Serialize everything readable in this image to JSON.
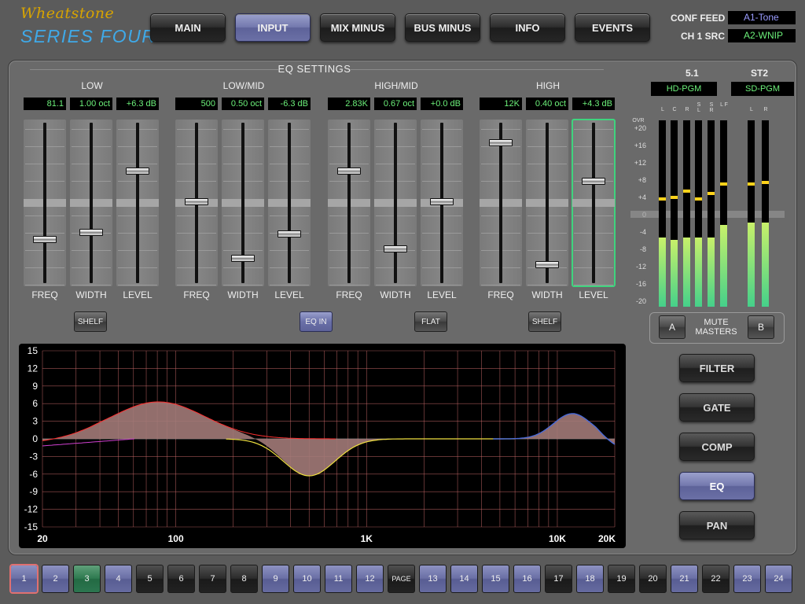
{
  "logo": {
    "line1": "Wheatstone",
    "line2": "SERIES FOUR"
  },
  "topnav": [
    {
      "label": "MAIN",
      "active": false
    },
    {
      "label": "INPUT",
      "active": true
    },
    {
      "label": "MIX MINUS",
      "active": false
    },
    {
      "label": "BUS MINUS",
      "active": false
    },
    {
      "label": "INFO",
      "active": false
    },
    {
      "label": "EVENTS",
      "active": false
    }
  ],
  "sources": {
    "conf_feed_label": "CONF FEED",
    "conf_feed_value": "A1-Tone",
    "conf_feed_color": "#9a9cff",
    "ch_src_label": "CH 1 SRC",
    "ch_src_value": "A2-WNIP",
    "ch_src_color": "#6cf07a"
  },
  "eq": {
    "title": "EQ SETTINGS",
    "bands": [
      {
        "name": "LOW",
        "freq": "81.1",
        "width": "1.00 oct",
        "level": "+6.3 dB",
        "knobs": [
          0.74,
          0.69,
          0.29
        ],
        "button": "SHELF",
        "button_active": false
      },
      {
        "name": "LOW/MID",
        "freq": "500",
        "width": "0.50 oct",
        "level": "-6.3 dB",
        "knobs": [
          0.49,
          0.86,
          0.7
        ],
        "button": "EQ IN",
        "button_active": true
      },
      {
        "name": "HIGH/MID",
        "freq": "2.83K",
        "width": "0.67 oct",
        "level": "+0.0 dB",
        "knobs": [
          0.29,
          0.8,
          0.49
        ],
        "button": "FLAT",
        "button_active": false
      },
      {
        "name": "HIGH",
        "freq": "12K",
        "width": "0.40 oct",
        "level": "+4.3 dB",
        "knobs": [
          0.11,
          0.9,
          0.36
        ],
        "button": "SHELF",
        "button_active": false
      }
    ],
    "fader_labels": [
      "FREQ",
      "WIDTH",
      "LEVEL"
    ],
    "selected_fader": "HIGH-LEVEL"
  },
  "graph": {
    "y_ticks": [
      "15",
      "12",
      "9",
      "6",
      "3",
      "0",
      "-3",
      "-6",
      "-9",
      "-12",
      "-15"
    ],
    "x_ticks": [
      "20",
      "100",
      "1K",
      "10K",
      "20K"
    ],
    "colors": {
      "grid": "#c86a6a",
      "fill": "#a27a78",
      "low": "#ff3030",
      "mid": "#f0e040",
      "high": "#4a6ad8",
      "lowshelf": "#d040d0"
    }
  },
  "meters": {
    "group1": "5.1",
    "group2": "ST2",
    "src1": "HD-PGM",
    "src2": "SD-PGM",
    "over_label": "OVR",
    "db_labels": [
      "+20",
      "+16",
      "+12",
      "+8",
      "+4",
      "0",
      "-4",
      "-8",
      "-12",
      "-16",
      "-20"
    ],
    "ch1": [
      "L",
      "C",
      "R",
      "S L",
      "S R",
      "L F"
    ],
    "ch2": [
      "L",
      "R"
    ],
    "levels": [
      0.37,
      0.36,
      0.37,
      0.37,
      0.37,
      0.44,
      0.45,
      0.45
    ],
    "peaks": [
      0.57,
      0.58,
      0.61,
      0.57,
      0.6,
      0.65,
      0.65,
      0.66
    ]
  },
  "mute": {
    "a": "A",
    "b": "B",
    "label1": "MUTE",
    "label2": "MASTERS"
  },
  "right_buttons": [
    {
      "label": "FILTER",
      "active": false
    },
    {
      "label": "GATE",
      "active": false
    },
    {
      "label": "COMP",
      "active": false
    },
    {
      "label": "EQ",
      "active": true
    },
    {
      "label": "PAN",
      "active": false
    }
  ],
  "channels": [
    {
      "label": "1",
      "style": "sel"
    },
    {
      "label": "2",
      "style": "blue"
    },
    {
      "label": "3",
      "style": "green"
    },
    {
      "label": "4",
      "style": "blue"
    },
    {
      "label": "5",
      "style": "dark"
    },
    {
      "label": "6",
      "style": "dark"
    },
    {
      "label": "7",
      "style": "dark"
    },
    {
      "label": "8",
      "style": "dark"
    },
    {
      "label": "9",
      "style": "blue"
    },
    {
      "label": "10",
      "style": "blue"
    },
    {
      "label": "11",
      "style": "blue"
    },
    {
      "label": "12",
      "style": "blue"
    },
    {
      "label": "PAGE",
      "style": "page"
    },
    {
      "label": "13",
      "style": "blue"
    },
    {
      "label": "14",
      "style": "blue"
    },
    {
      "label": "15",
      "style": "blue"
    },
    {
      "label": "16",
      "style": "blue"
    },
    {
      "label": "17",
      "style": "dark"
    },
    {
      "label": "18",
      "style": "blue"
    },
    {
      "label": "19",
      "style": "dark"
    },
    {
      "label": "20",
      "style": "dark"
    },
    {
      "label": "21",
      "style": "blue"
    },
    {
      "label": "22",
      "style": "dark"
    },
    {
      "label": "23",
      "style": "blue"
    },
    {
      "label": "24",
      "style": "blue"
    }
  ]
}
